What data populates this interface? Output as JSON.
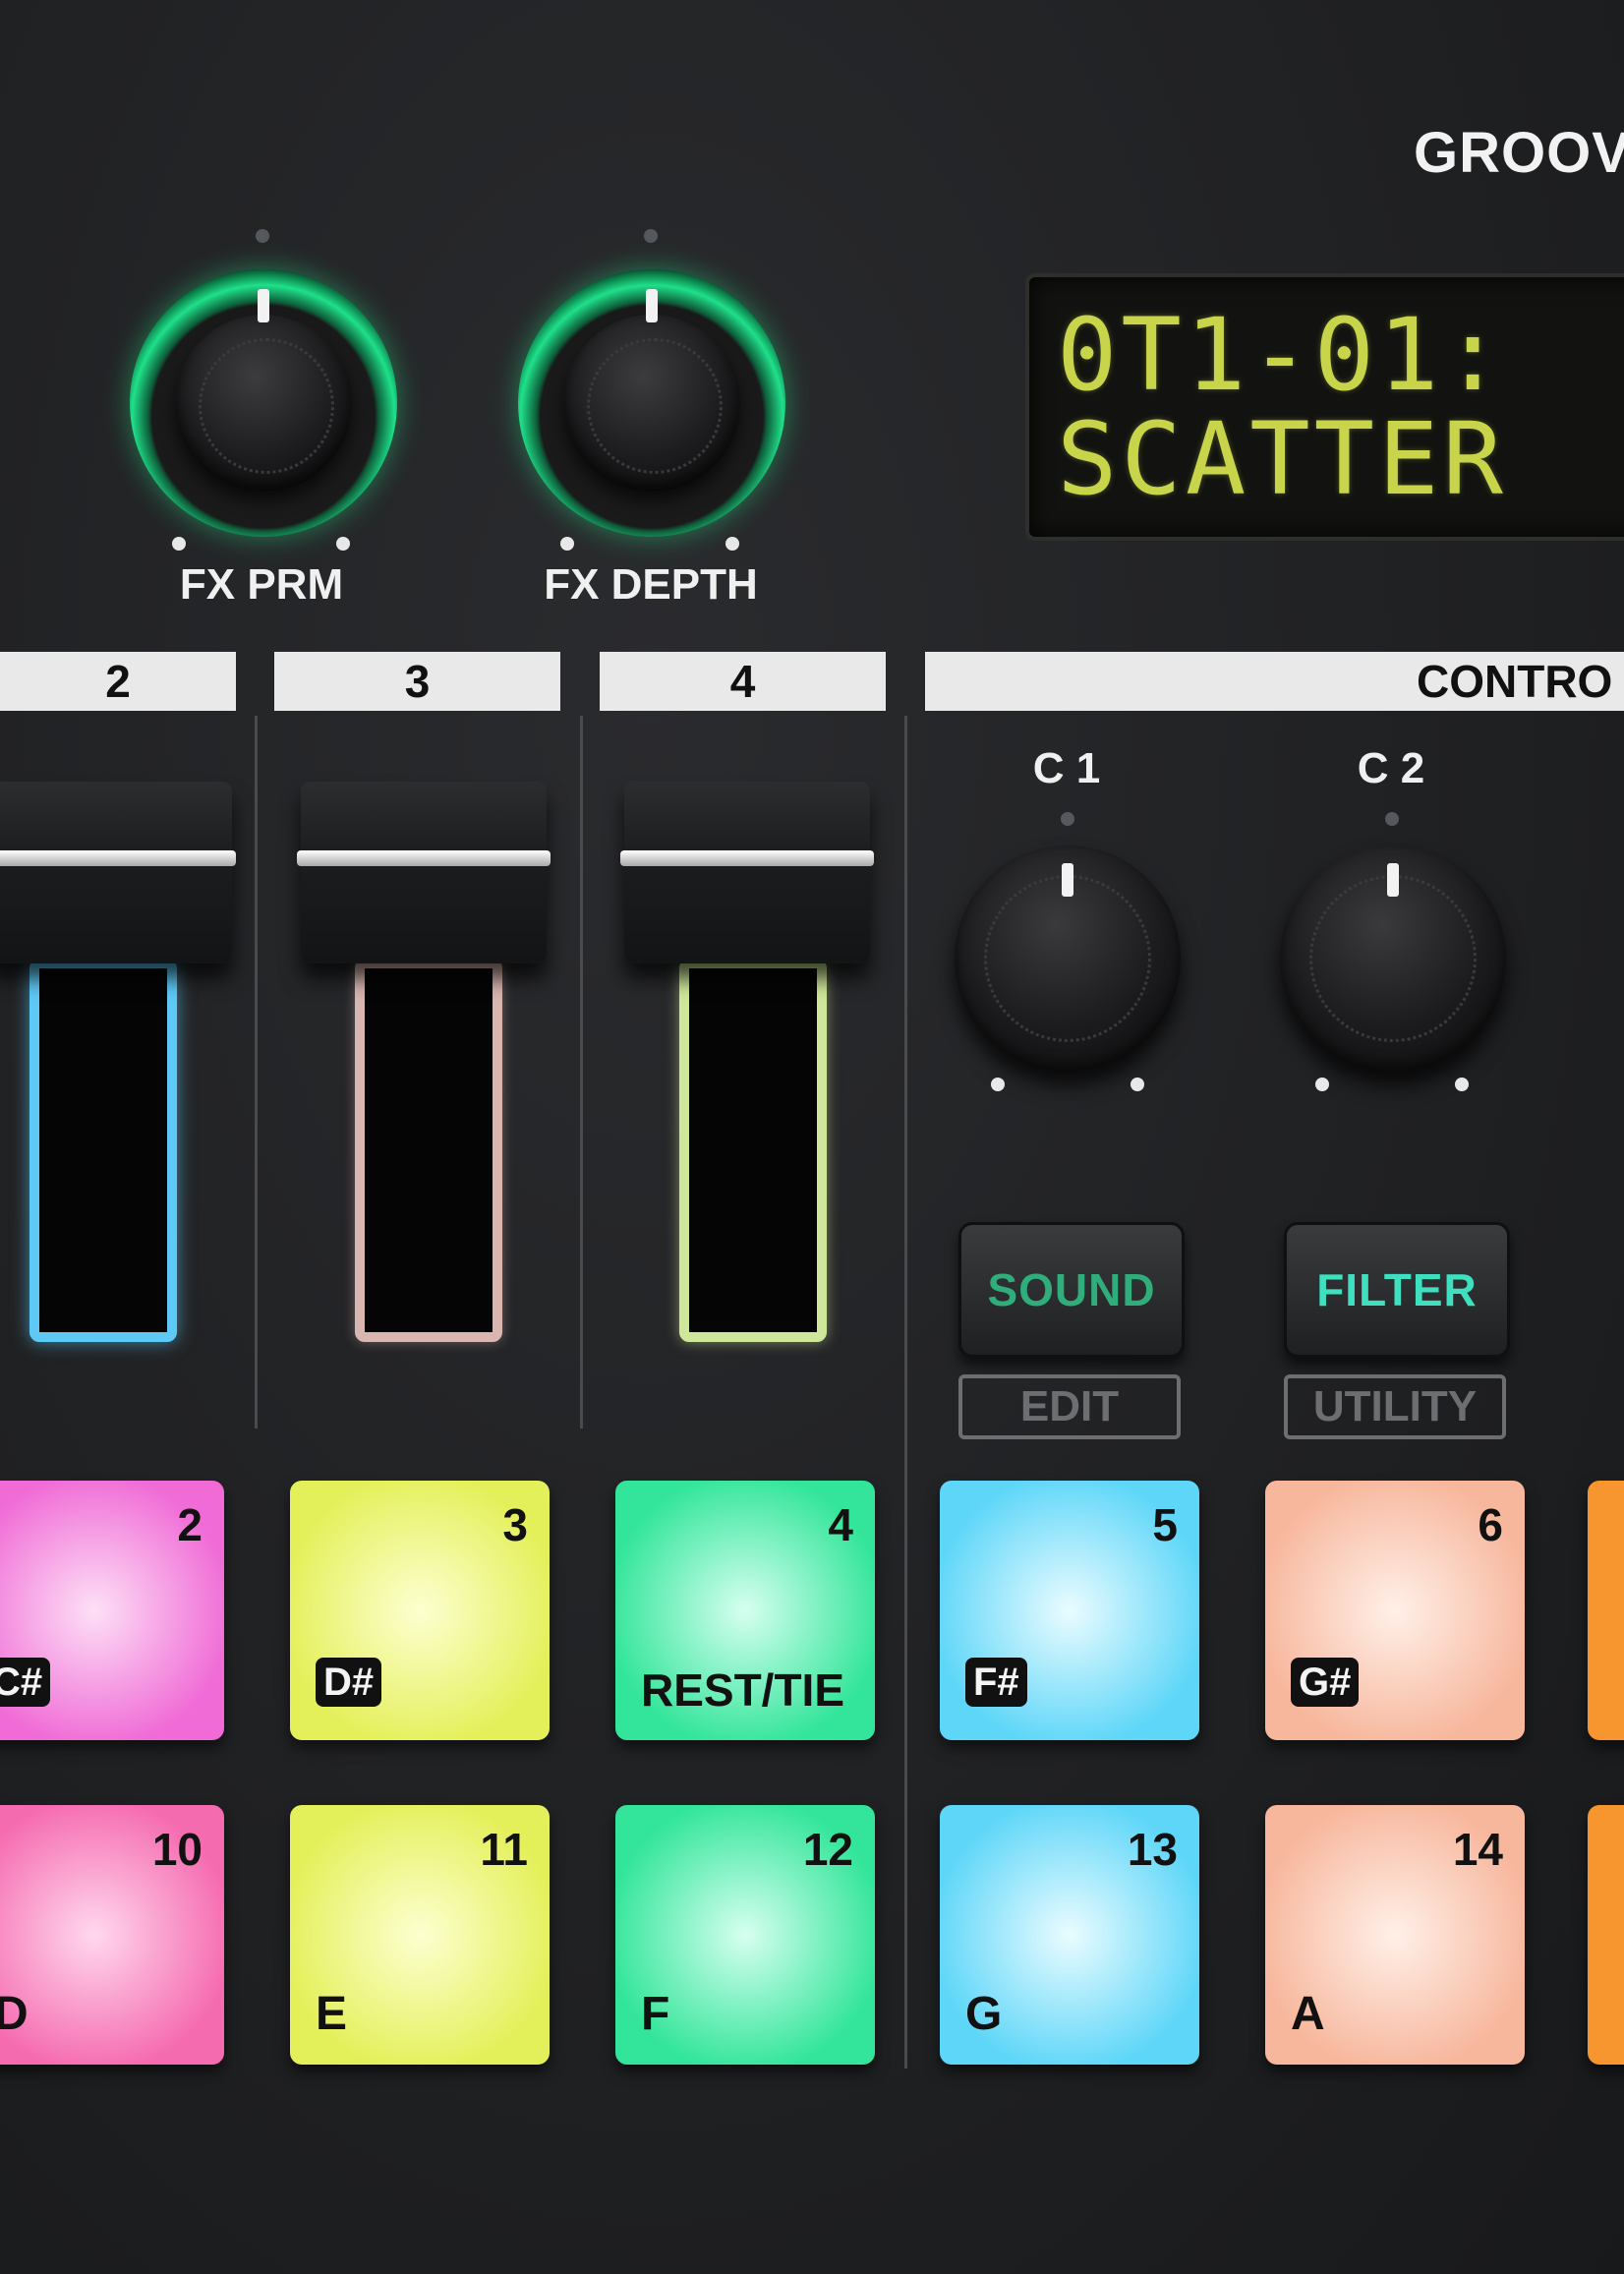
{
  "brand": "GROOV",
  "fx_knobs": [
    {
      "label": "FX PRM"
    },
    {
      "label": "FX DEPTH"
    }
  ],
  "lcd": {
    "line1": "0T1-01:",
    "line2": "SCATTER"
  },
  "tracks": [
    "2",
    "3",
    "4"
  ],
  "control_header": "CONTRO",
  "control_knobs": [
    {
      "label": "C 1"
    },
    {
      "label": "C 2"
    }
  ],
  "buttons": [
    {
      "label": "SOUND",
      "sub_label": "EDIT",
      "color": "#2fae7c"
    },
    {
      "label": "FILTER",
      "sub_label": "UTILITY",
      "color": "#3ee0c0"
    }
  ],
  "fader_colors": [
    "#5ec9f5",
    "#d9b6b0",
    "#cfe79a"
  ],
  "pads_row1": [
    {
      "number": "2",
      "note": "C#",
      "tag": true,
      "color": "#f06bd6"
    },
    {
      "number": "3",
      "note": "D#",
      "tag": true,
      "color": "#e4f05a"
    },
    {
      "number": "4",
      "note": "REST/TIE",
      "tag": false,
      "color": "#33e59a"
    },
    {
      "number": "5",
      "note": "F#",
      "tag": true,
      "color": "#5ed6f8"
    },
    {
      "number": "6",
      "note": "G#",
      "tag": true,
      "color": "#f7b79d"
    }
  ],
  "pads_row2": [
    {
      "number": "10",
      "note": "D",
      "color": "#f56bb0"
    },
    {
      "number": "11",
      "note": "E",
      "color": "#e4f05a"
    },
    {
      "number": "12",
      "note": "F",
      "color": "#33e59a"
    },
    {
      "number": "13",
      "note": "G",
      "color": "#5ed6f8"
    },
    {
      "number": "14",
      "note": "A",
      "color": "#f7b79d"
    }
  ]
}
